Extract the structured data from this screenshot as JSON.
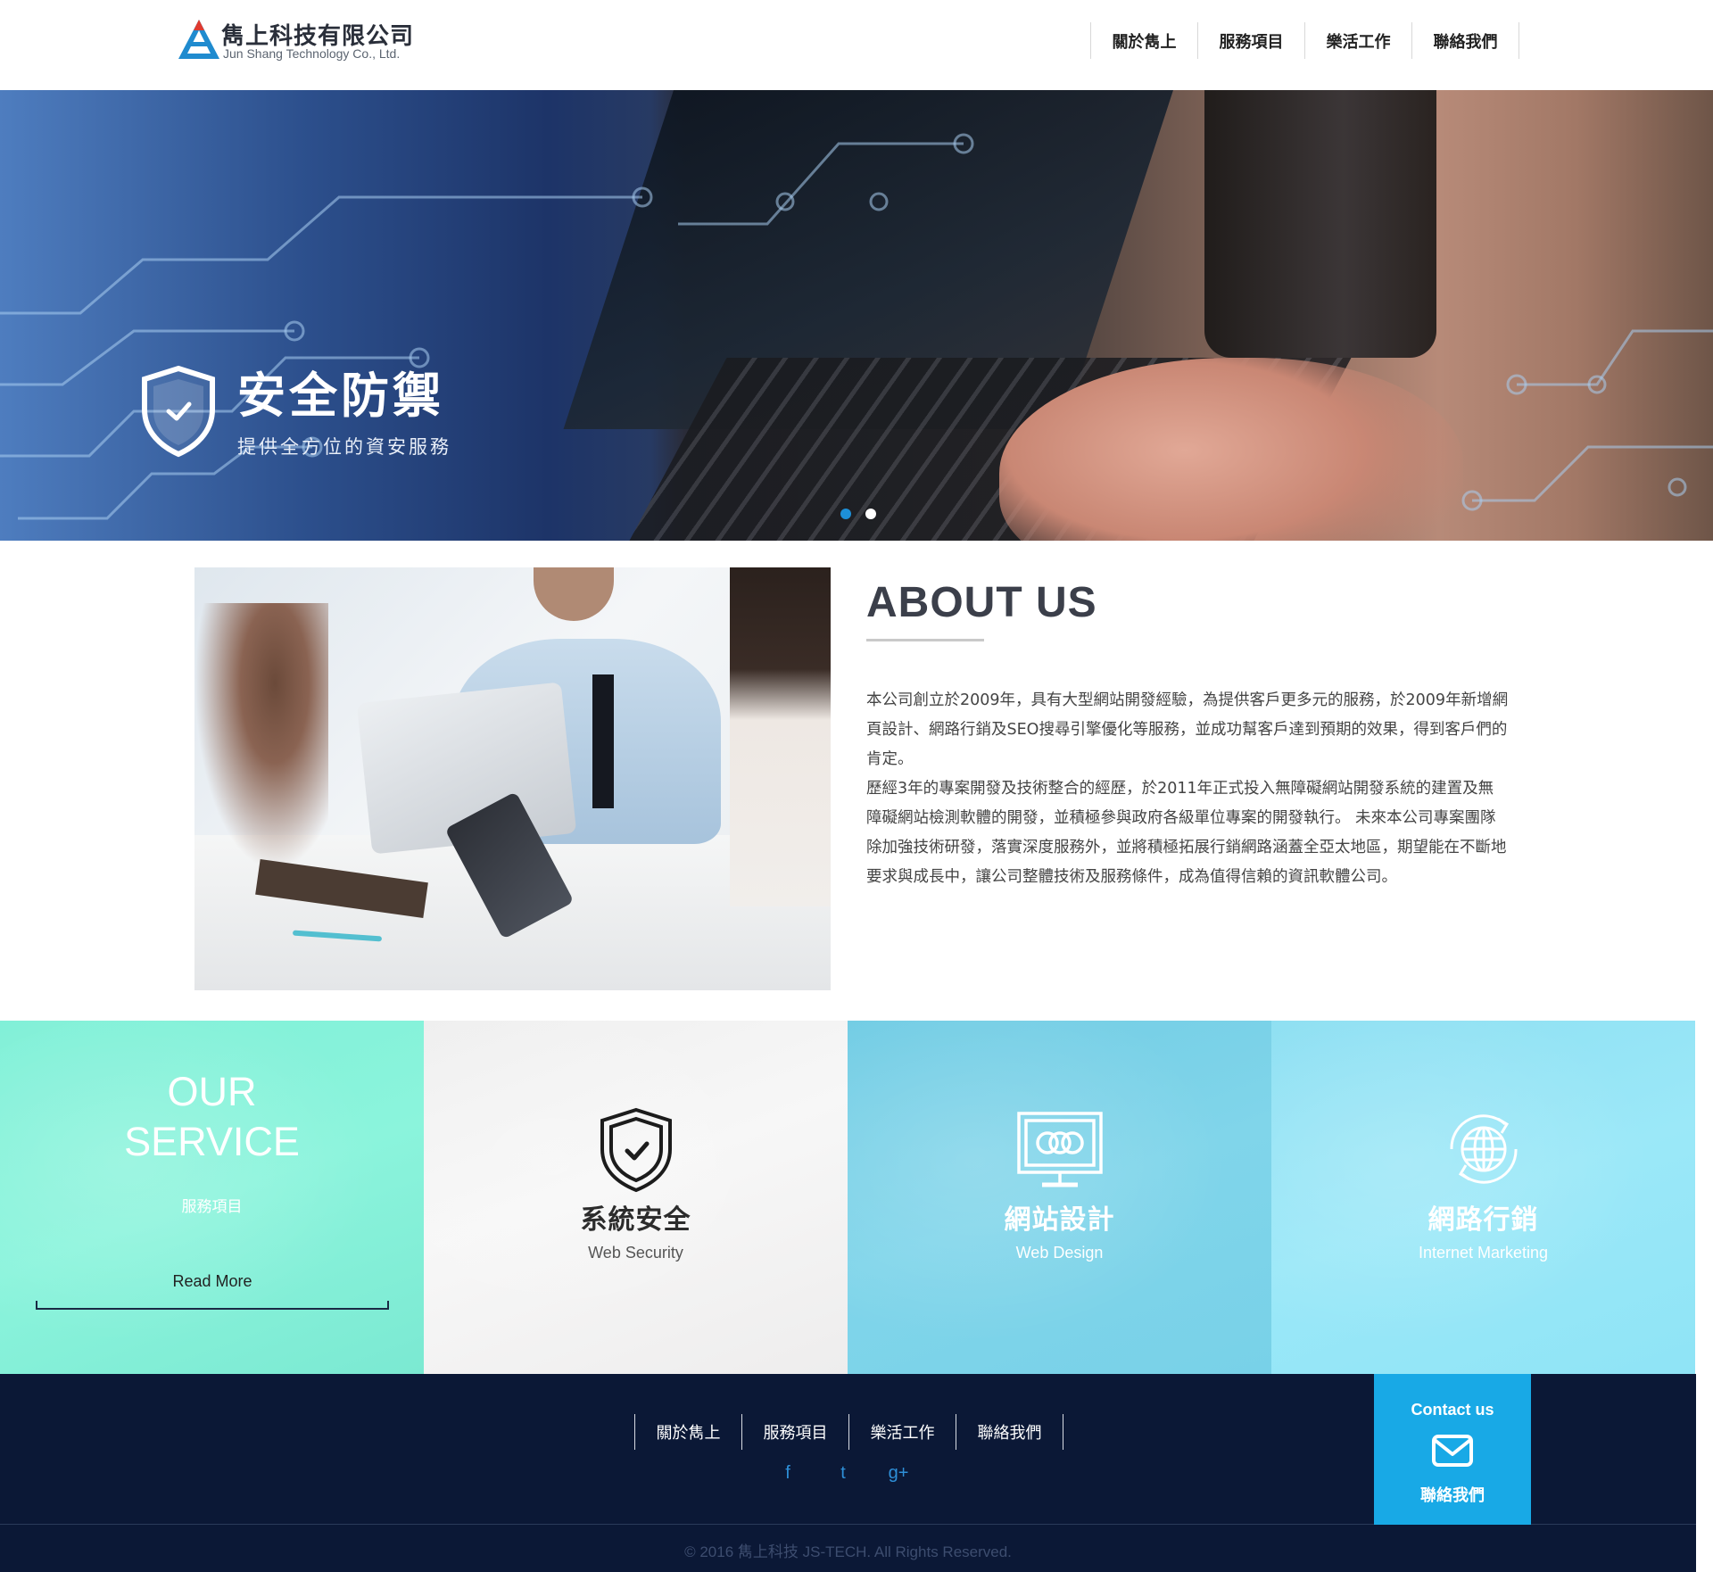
{
  "header": {
    "logo_cn": "雋上科技有限公司",
    "logo_en": "Jun Shang Technology Co., Ltd.",
    "nav": [
      "關於雋上",
      "服務項目",
      "樂活工作",
      "聯絡我們"
    ]
  },
  "hero": {
    "title": "安全防禦",
    "subtitle": "提供全方位的資安服務",
    "icon": "shield-check-icon",
    "slide_count": 2,
    "active_slide": 0,
    "accent": "#1d8fd8"
  },
  "about": {
    "title": "ABOUT US",
    "paragraphs": [
      "本公司創立於2009年，具有大型網站開發經驗，為提供客戶更多元的服務，於2009年新增網頁設計、網路行銷及SEO搜尋引擎優化等服務，並成功幫客戶達到預期的效果，得到客戶們的肯定。",
      "歷經3年的專案開發及技術整合的經歷，於2011年正式投入無障礙網站開發系統的建置及無障礙網站檢測軟體的開發，並積極參與政府各級單位專案的開發執行。 未來本公司專案團隊除加強技術研發，落實深度服務外，並將積極拓展行銷網路涵蓋全亞太地區，期望能在不斷地要求與成長中，讓公司整體技術及服務條件，成為值得信賴的資訊軟體公司。"
    ]
  },
  "services": {
    "intro_heading_line1": "OUR",
    "intro_heading_line2": "SERVICE",
    "intro_sub": "服務項目",
    "read_more": "Read More",
    "items": [
      {
        "title": "系統安全",
        "subtitle": "Web Security",
        "icon": "shield-check-icon"
      },
      {
        "title": "網站設計",
        "subtitle": "Web Design",
        "icon": "monitor-icon"
      },
      {
        "title": "網路行銷",
        "subtitle": "Internet Marketing",
        "icon": "globe-icon"
      }
    ],
    "colors": [
      "#80f1d8",
      "#f3f3f3",
      "#7ad2e8",
      "#94e5f6"
    ]
  },
  "footer": {
    "nav": [
      "關於雋上",
      "服務項目",
      "樂活工作",
      "聯絡我們"
    ],
    "social": [
      "facebook-icon",
      "twitter-icon",
      "google-plus-icon"
    ],
    "social_glyphs": [
      "f",
      "t",
      "g+"
    ],
    "copyright": "© 2016 雋上科技 JS-TECH. All Rights Reserved.",
    "contact_en": "Contact us",
    "contact_cn": "聯絡我們",
    "contact_icon": "mail-icon",
    "background": "#0b1836",
    "contact_color": "#18a9e6"
  }
}
